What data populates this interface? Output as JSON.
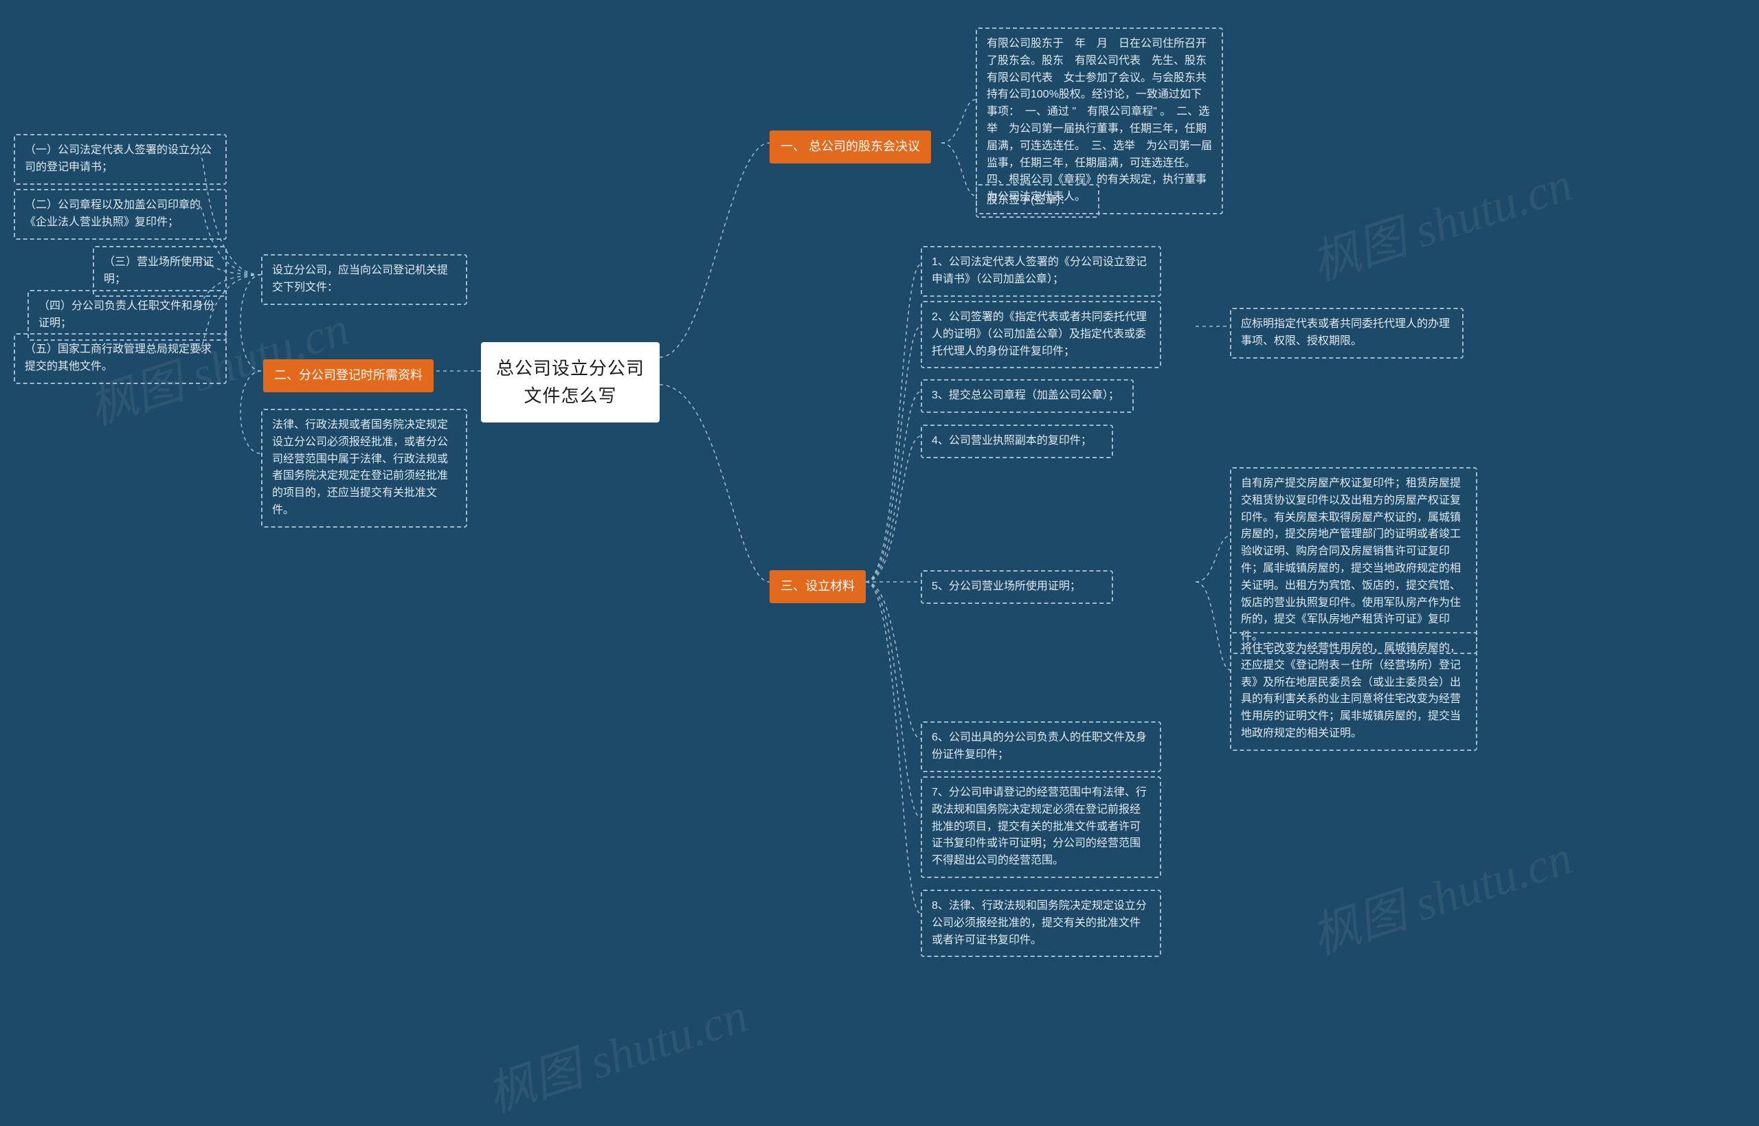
{
  "center": "总公司设立分公司文件怎么写",
  "branch1": {
    "title": "一、 总公司的股东会决议",
    "c1": "有限公司股东于　年　月　日在公司住所召开了股东会。股东　有限公司代表　先生、股东　有限公司代表　女士参加了会议。与会股东共持有公司100%股权。经讨论，一致通过如下事项：　一、通过 \"　有限公司章程\" 。　二、选举　为公司第一届执行董事，任期三年，任期届满，可连选连任。　三、选举　为公司第一届监事，任期三年，任期届满，可连选连任。　四、根据公司《章程》的有关规定，执行董事　为公司法定代表人。",
    "c2": "股东签字(签章)："
  },
  "branch3": {
    "title": "三、设立材料",
    "c1": "1、公司法定代表人签署的《分公司设立登记申请书》（公司加盖公章）；",
    "c2": "2、公司签署的《指定代表或者共同委托代理人的证明》（公司加盖公章）及指定代表或委托代理人的身份证件复印件；",
    "c2a": "应标明指定代表或者共同委托代理人的办理事项、权限、授权期限。",
    "c3": "3、提交总公司章程（加盖公司公章）；",
    "c4": "4、公司营业执照副本的复印件；",
    "c5": "5、分公司营业场所使用证明；",
    "c5a": "自有房产提交房屋产权证复印件；租赁房屋提交租赁协议复印件以及出租方的房屋产权证复印件。有关房屋未取得房屋产权证的，属城镇房屋的，提交房地产管理部门的证明或者竣工验收证明、购房合同及房屋销售许可证复印件；属非城镇房屋的，提交当地政府规定的相关证明。出租方为宾馆、饭店的，提交宾馆、饭店的营业执照复印件。使用军队房产作为住所的，提交《军队房地产租赁许可证》复印件。",
    "c5b": "将住宅改变为经营性用房的，属城镇房屋的，还应提交《登记附表－住所（经营场所）登记表》及所在地居民委员会（或业主委员会）出具的有利害关系的业主同意将住宅改变为经营性用房的证明文件；属非城镇房屋的，提交当地政府规定的相关证明。",
    "c6": "6、公司出具的分公司负责人的任职文件及身份证件复印件；",
    "c7": "7、分公司申请登记的经营范围中有法律、行政法规和国务院决定规定必须在登记前报经批准的项目，提交有关的批准文件或者许可证书复印件或许可证明；分公司的经营范围不得超出公司的经营范围。",
    "c8": "8、法律、行政法规和国务院决定规定设立分公司必须报经批准的，提交有关的批准文件或者许可证书复印件。"
  },
  "branch2": {
    "title": "二、分公司登记时所需资料",
    "p1": "设立分公司，应当向公司登记机关提交下列文件：",
    "p1a": "（一）公司法定代表人签署的设立分公司的登记申请书；",
    "p1b": "（二）公司章程以及加盖公司印章的《企业法人营业执照》复印件；",
    "p1c": "（三）营业场所使用证明；",
    "p1d": "（四）分公司负责人任职文件和身份证明；",
    "p1e": "（五）国家工商行政管理总局规定要求提交的其他文件。",
    "p2": "法律、行政法规或者国务院决定规定设立分公司必须报经批准，或者分公司经营范围中属于法律、行政法规或者国务院决定规定在登记前须经批准的项目的，还应当提交有关批准文件。"
  },
  "watermark": "枫图 shutu.cn"
}
